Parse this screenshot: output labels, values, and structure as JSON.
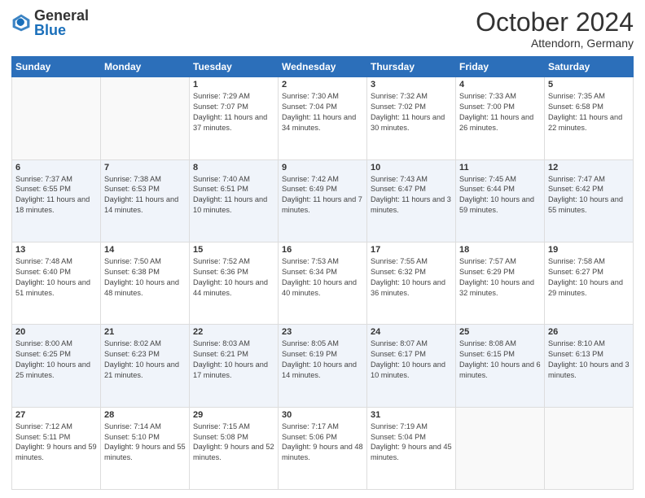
{
  "logo": {
    "general": "General",
    "blue": "Blue"
  },
  "header": {
    "month": "October 2024",
    "location": "Attendorn, Germany"
  },
  "weekdays": [
    "Sunday",
    "Monday",
    "Tuesday",
    "Wednesday",
    "Thursday",
    "Friday",
    "Saturday"
  ],
  "weeks": [
    [
      {
        "day": "",
        "info": ""
      },
      {
        "day": "",
        "info": ""
      },
      {
        "day": "1",
        "info": "Sunrise: 7:29 AM\nSunset: 7:07 PM\nDaylight: 11 hours\nand 37 minutes."
      },
      {
        "day": "2",
        "info": "Sunrise: 7:30 AM\nSunset: 7:04 PM\nDaylight: 11 hours\nand 34 minutes."
      },
      {
        "day": "3",
        "info": "Sunrise: 7:32 AM\nSunset: 7:02 PM\nDaylight: 11 hours\nand 30 minutes."
      },
      {
        "day": "4",
        "info": "Sunrise: 7:33 AM\nSunset: 7:00 PM\nDaylight: 11 hours\nand 26 minutes."
      },
      {
        "day": "5",
        "info": "Sunrise: 7:35 AM\nSunset: 6:58 PM\nDaylight: 11 hours\nand 22 minutes."
      }
    ],
    [
      {
        "day": "6",
        "info": "Sunrise: 7:37 AM\nSunset: 6:55 PM\nDaylight: 11 hours\nand 18 minutes."
      },
      {
        "day": "7",
        "info": "Sunrise: 7:38 AM\nSunset: 6:53 PM\nDaylight: 11 hours\nand 14 minutes."
      },
      {
        "day": "8",
        "info": "Sunrise: 7:40 AM\nSunset: 6:51 PM\nDaylight: 11 hours\nand 10 minutes."
      },
      {
        "day": "9",
        "info": "Sunrise: 7:42 AM\nSunset: 6:49 PM\nDaylight: 11 hours\nand 7 minutes."
      },
      {
        "day": "10",
        "info": "Sunrise: 7:43 AM\nSunset: 6:47 PM\nDaylight: 11 hours\nand 3 minutes."
      },
      {
        "day": "11",
        "info": "Sunrise: 7:45 AM\nSunset: 6:44 PM\nDaylight: 10 hours\nand 59 minutes."
      },
      {
        "day": "12",
        "info": "Sunrise: 7:47 AM\nSunset: 6:42 PM\nDaylight: 10 hours\nand 55 minutes."
      }
    ],
    [
      {
        "day": "13",
        "info": "Sunrise: 7:48 AM\nSunset: 6:40 PM\nDaylight: 10 hours\nand 51 minutes."
      },
      {
        "day": "14",
        "info": "Sunrise: 7:50 AM\nSunset: 6:38 PM\nDaylight: 10 hours\nand 48 minutes."
      },
      {
        "day": "15",
        "info": "Sunrise: 7:52 AM\nSunset: 6:36 PM\nDaylight: 10 hours\nand 44 minutes."
      },
      {
        "day": "16",
        "info": "Sunrise: 7:53 AM\nSunset: 6:34 PM\nDaylight: 10 hours\nand 40 minutes."
      },
      {
        "day": "17",
        "info": "Sunrise: 7:55 AM\nSunset: 6:32 PM\nDaylight: 10 hours\nand 36 minutes."
      },
      {
        "day": "18",
        "info": "Sunrise: 7:57 AM\nSunset: 6:29 PM\nDaylight: 10 hours\nand 32 minutes."
      },
      {
        "day": "19",
        "info": "Sunrise: 7:58 AM\nSunset: 6:27 PM\nDaylight: 10 hours\nand 29 minutes."
      }
    ],
    [
      {
        "day": "20",
        "info": "Sunrise: 8:00 AM\nSunset: 6:25 PM\nDaylight: 10 hours\nand 25 minutes."
      },
      {
        "day": "21",
        "info": "Sunrise: 8:02 AM\nSunset: 6:23 PM\nDaylight: 10 hours\nand 21 minutes."
      },
      {
        "day": "22",
        "info": "Sunrise: 8:03 AM\nSunset: 6:21 PM\nDaylight: 10 hours\nand 17 minutes."
      },
      {
        "day": "23",
        "info": "Sunrise: 8:05 AM\nSunset: 6:19 PM\nDaylight: 10 hours\nand 14 minutes."
      },
      {
        "day": "24",
        "info": "Sunrise: 8:07 AM\nSunset: 6:17 PM\nDaylight: 10 hours\nand 10 minutes."
      },
      {
        "day": "25",
        "info": "Sunrise: 8:08 AM\nSunset: 6:15 PM\nDaylight: 10 hours\nand 6 minutes."
      },
      {
        "day": "26",
        "info": "Sunrise: 8:10 AM\nSunset: 6:13 PM\nDaylight: 10 hours\nand 3 minutes."
      }
    ],
    [
      {
        "day": "27",
        "info": "Sunrise: 7:12 AM\nSunset: 5:11 PM\nDaylight: 9 hours\nand 59 minutes."
      },
      {
        "day": "28",
        "info": "Sunrise: 7:14 AM\nSunset: 5:10 PM\nDaylight: 9 hours\nand 55 minutes."
      },
      {
        "day": "29",
        "info": "Sunrise: 7:15 AM\nSunset: 5:08 PM\nDaylight: 9 hours\nand 52 minutes."
      },
      {
        "day": "30",
        "info": "Sunrise: 7:17 AM\nSunset: 5:06 PM\nDaylight: 9 hours\nand 48 minutes."
      },
      {
        "day": "31",
        "info": "Sunrise: 7:19 AM\nSunset: 5:04 PM\nDaylight: 9 hours\nand 45 minutes."
      },
      {
        "day": "",
        "info": ""
      },
      {
        "day": "",
        "info": ""
      }
    ]
  ]
}
